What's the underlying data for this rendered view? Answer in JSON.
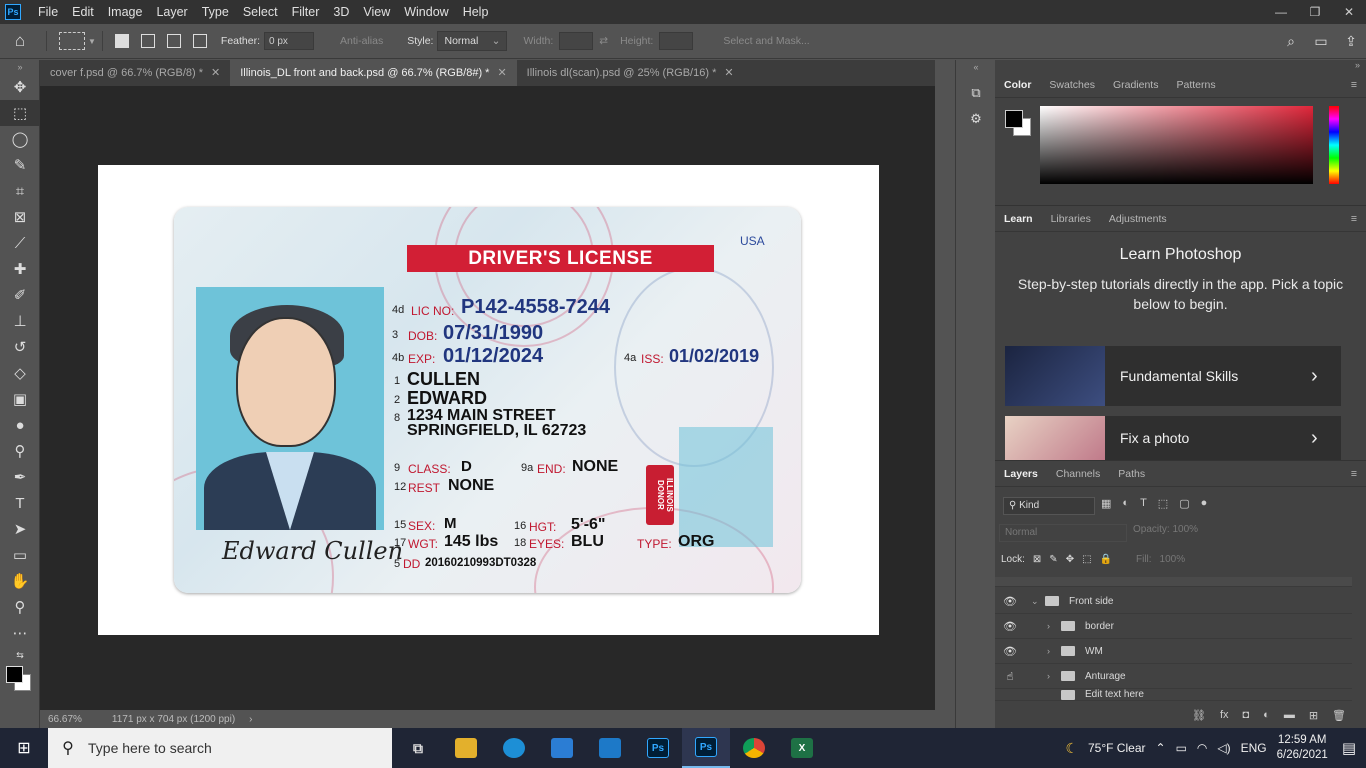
{
  "app": {
    "logo": "Ps"
  },
  "menu": [
    "File",
    "Edit",
    "Image",
    "Layer",
    "Type",
    "Select",
    "Filter",
    "3D",
    "View",
    "Window",
    "Help"
  ],
  "window_controls": {
    "minimize": "—",
    "restore": "❐",
    "close": "✕"
  },
  "options": {
    "feather_label": "Feather:",
    "feather_value": "0 px",
    "antialias_label": "Anti-alias",
    "style_label": "Style:",
    "style_value": "Normal",
    "width_label": "Width:",
    "height_label": "Height:",
    "select_mask_label": "Select and Mask..."
  },
  "tabs": [
    {
      "label": "cover f.psd @ 66.7% (RGB/8) *",
      "active": false
    },
    {
      "label": "Illinois_DL front and back.psd @ 66.7% (RGB/8#) *",
      "active": true
    },
    {
      "label": "Illinois dl(scan).psd @ 25% (RGB/16) *",
      "active": false
    }
  ],
  "card": {
    "title": "DRIVER'S LICENSE",
    "country": "USA",
    "lic_num_code": "4d",
    "lic_label": "LIC NO:",
    "lic_value": "P142-4558-7244",
    "dob_num": "3",
    "dob_label": "DOB:",
    "dob_value": "07/31/1990",
    "exp_num": "4b",
    "exp_label": "EXP:",
    "exp_value": "01/12/2024",
    "iss_num": "4a",
    "iss_label": "ISS:",
    "iss_value": "01/02/2019",
    "last_num": "1",
    "last_name": "CULLEN",
    "first_num": "2",
    "first_name": "EDWARD",
    "addr_num": "8",
    "address1": "1234 MAIN STREET",
    "address2": "SPRINGFIELD, IL 62723",
    "class_num": "9",
    "class_label": "CLASS:",
    "class_value": "D",
    "end_num": "9a",
    "end_label": "END:",
    "end_value": "NONE",
    "rest_num": "12",
    "rest_label": "REST",
    "rest_value": "NONE",
    "sex_num": "15",
    "sex_label": "SEX:",
    "sex_value": "M",
    "hgt_num": "16",
    "hgt_label": "HGT:",
    "hgt_value": "5'-6\"",
    "wgt_num": "17",
    "wgt_label": "WGT:",
    "wgt_value": "145 lbs",
    "eyes_num": "18",
    "eyes_label": "EYES:",
    "eyes_value": "BLU",
    "type_label": "TYPE:",
    "type_value": "ORG",
    "dd_num": "5",
    "dd_label": "DD",
    "dd_value": "20160210993DT0328",
    "signature": "Edward Cullen",
    "donor_text": "ILLINOIS DONOR"
  },
  "color_panel": {
    "tabs": [
      "Color",
      "Swatches",
      "Gradients",
      "Patterns"
    ]
  },
  "learn_panel": {
    "tabs": [
      "Learn",
      "Libraries",
      "Adjustments"
    ],
    "title": "Learn Photoshop",
    "description": "Step-by-step tutorials directly in the app. Pick a topic below to begin.",
    "cards": [
      "Fundamental Skills",
      "Fix a photo"
    ]
  },
  "layers_panel": {
    "tabs": [
      "Layers",
      "Channels",
      "Paths"
    ],
    "filter_value": "Kind",
    "blend_value": "Normal",
    "opacity_label": "Opacity:",
    "opacity_value": "100%",
    "lock_label": "Lock:",
    "fill_label": "Fill:",
    "fill_value": "100%",
    "layers": [
      {
        "name": "Front side",
        "level": 0,
        "visible": true
      },
      {
        "name": "border",
        "level": 1,
        "visible": true
      },
      {
        "name": "WM",
        "level": 1,
        "visible": true
      },
      {
        "name": "Anturage",
        "level": 1,
        "visible": false
      },
      {
        "name": "Edit text here",
        "level": 1,
        "visible": false
      }
    ]
  },
  "status": {
    "zoom": "66.67%",
    "doc_info": "1171 px x 704 px (1200 ppi)"
  },
  "taskbar": {
    "search_placeholder": "Type here to search",
    "weather": "75°F  Clear",
    "language": "ENG",
    "time": "12:59 AM",
    "date": "6/26/2021"
  },
  "colors": {
    "title_red": "#d21f35",
    "license_blue": "#21367f",
    "photo_bg": "#6ec3d9",
    "ps_blue": "#31a8ff"
  }
}
